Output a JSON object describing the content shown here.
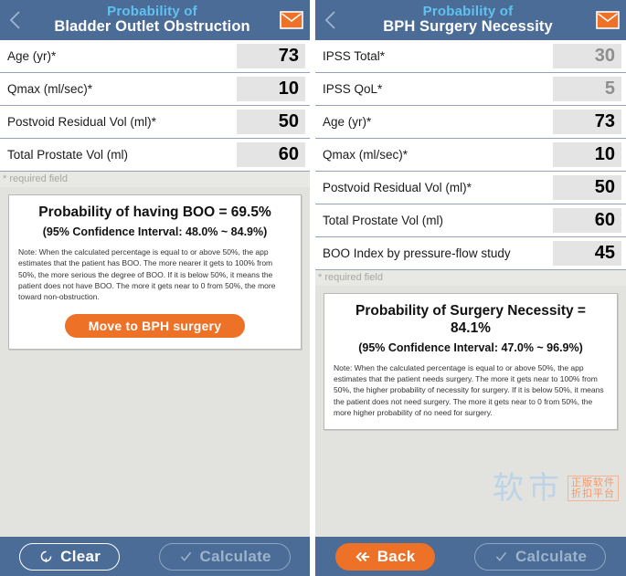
{
  "screens": [
    {
      "id": "boo",
      "header": {
        "back_icon": "chevron-left-icon",
        "mail_icon": "envelope-icon",
        "title_line1": "Probability of",
        "title_line2": "Bladder Outlet Obstruction"
      },
      "fields": [
        {
          "label": "Age (yr)*",
          "value": "73",
          "muted": false
        },
        {
          "label": "Qmax (ml/sec)*",
          "value": "10",
          "muted": false
        },
        {
          "label": "Postvoid Residual Vol (ml)*",
          "value": "50",
          "muted": false
        },
        {
          "label": "Total Prostate Vol (ml)",
          "value": "60",
          "muted": false
        }
      ],
      "required_note": "* required field",
      "result": {
        "headline": "Probability of having BOO = 69.5%",
        "confidence_interval": "(95% Confidence Interval: 48.0% ~ 84.9%)",
        "note": "Note: When the calculated percentage is equal to or above 50%, the app estimates that the patient has BOO. The more nearer it gets to 100% from 50%, the more serious the degree of BOO. If it is below 50%, it means the patient does not have BOO. The more it gets near to 0 from 50%, the more toward non-obstruction.",
        "cta_label": "Move to BPH surgery"
      },
      "toolbar": [
        {
          "label": "Clear",
          "icon": "refresh-icon",
          "style": "outline-bright",
          "name": "clear-button"
        },
        {
          "label": "Calculate",
          "icon": "check-icon",
          "style": "outline-dim",
          "name": "calculate-button"
        }
      ]
    },
    {
      "id": "bph",
      "header": {
        "back_icon": "chevron-left-icon",
        "mail_icon": "envelope-icon",
        "title_line1": "Probability of",
        "title_line2": "BPH Surgery Necessity"
      },
      "fields": [
        {
          "label": "IPSS Total*",
          "value": "30",
          "muted": true
        },
        {
          "label": "IPSS QoL*",
          "value": "5",
          "muted": true
        },
        {
          "label": "Age (yr)*",
          "value": "73",
          "muted": false
        },
        {
          "label": "Qmax (ml/sec)*",
          "value": "10",
          "muted": false
        },
        {
          "label": "Postvoid Residual Vol (ml)*",
          "value": "50",
          "muted": false
        },
        {
          "label": "Total Prostate Vol (ml)",
          "value": "60",
          "muted": false
        },
        {
          "label": "BOO Index by pressure-flow study",
          "value": "45",
          "muted": false
        }
      ],
      "required_note": "* required field",
      "result": {
        "headline": "Probability of Surgery Necessity = 84.1%",
        "confidence_interval": "(95% Confidence Interval: 47.0% ~ 96.9%)",
        "note": "Note: When the calculated percentage is equal to or above 50%, the app estimates that the patient needs surgery. The more it gets near to 100% from 50%, the higher probability of necessity for surgery. If it is below 50%, it means the patient does not need surgery. The more it gets near to 0 from 50%, the more higher probability of  no need for surgery.",
        "cta_label": ""
      },
      "toolbar": [
        {
          "label": "Back",
          "icon": "double-arrow-left-icon",
          "style": "filled-orange",
          "name": "back-button"
        },
        {
          "label": "Calculate",
          "icon": "check-icon",
          "style": "outline-dim",
          "name": "calculate-button"
        }
      ],
      "watermark": {
        "text": "软市",
        "badge_line1": "正版软件",
        "badge_line2": "折扣平台"
      }
    }
  ],
  "colors": {
    "header_blue": "#4a6c96",
    "title_cyan": "#5fc2f0",
    "accent_orange": "#ed7126",
    "page_bg": "#e2e2de",
    "row_divider": "#8fa3bc",
    "value_bg": "#e4e4e4"
  }
}
